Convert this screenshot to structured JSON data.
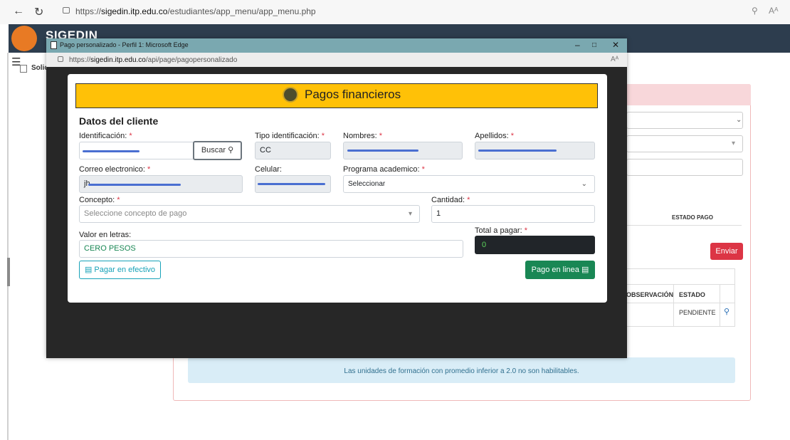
{
  "browser": {
    "url_prefix": "https://",
    "url_host": "sigedin.itp.edu.co",
    "url_path": "/estudiantes/app_menu/app_menu.php",
    "read_aloud": "Aᴬ"
  },
  "app": {
    "title": "SIGEDIN",
    "breadcrumb": "Solic",
    "bg_table": {
      "header_estado_pago": "ESTADO PAGO",
      "col_observacion": "OBSERVACIÓN",
      "col_estado": "ESTADO",
      "row_estado": "PENDIENTE"
    },
    "enviar_label": "Enviar",
    "alert_text": "Las unidades de formación con promedio inferior a 2.0 no son habilitables."
  },
  "popup": {
    "window_title": "Pago personalizado - Perfil 1: Microsoft Edge",
    "url_prefix": "https://",
    "url_host": "sigedin.itp.edu.co",
    "url_path": "/api/page/pagopersonalizado",
    "read_aloud": "Aᴬ"
  },
  "modal": {
    "banner_title": "Pagos financieros",
    "section_title": "Datos del cliente",
    "fields": {
      "identificacion_label": "Identificación:",
      "tipo_label": "Tipo identificación:",
      "tipo_value": "CC",
      "nombres_label": "Nombres:",
      "apellidos_label": "Apellidos:",
      "correo_label": "Correo electronico:",
      "correo_prefix": "jh",
      "celular_label": "Celular:",
      "programa_label": "Programa academico:",
      "programa_value": "Seleccionar",
      "concepto_label": "Concepto:",
      "concepto_placeholder": "Seleccione concepto de pago",
      "cantidad_label": "Cantidad:",
      "cantidad_value": "1",
      "valor_letras_label": "Valor en letras:",
      "valor_letras_value": "CERO PESOS",
      "total_label": "Total a pagar:",
      "total_value": "0",
      "required_mark": "*"
    },
    "buttons": {
      "buscar": "Buscar",
      "efectivo": "Pagar en efectivo",
      "linea": "Pago en linea"
    }
  },
  "colors": {
    "banner": "#ffc107",
    "primary_green": "#198754",
    "danger": "#dc3545",
    "info": "#17a2b8"
  }
}
